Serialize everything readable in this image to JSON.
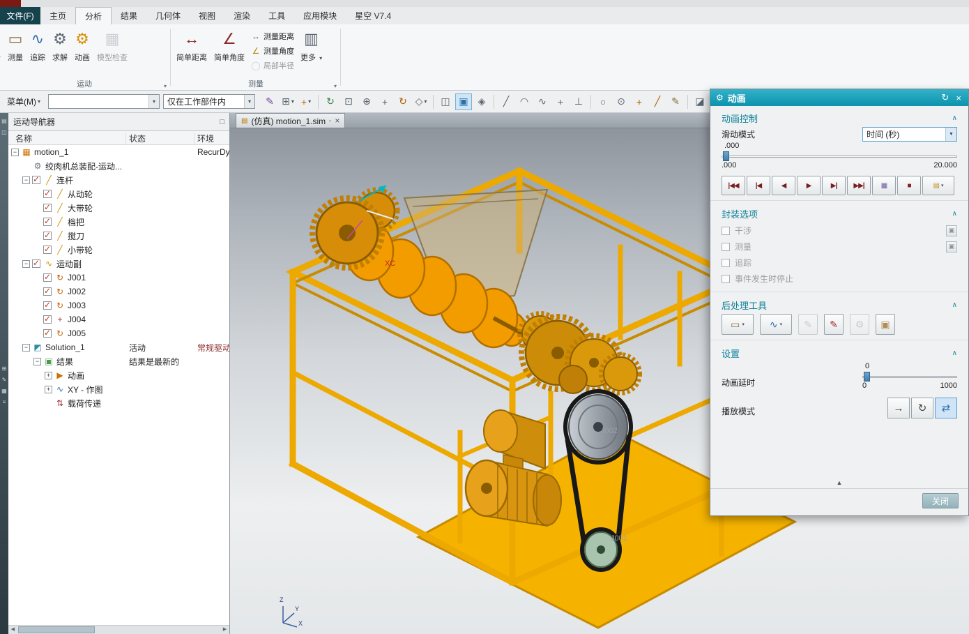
{
  "colors": {
    "accent_teal": "#1199b5",
    "section_teal": "#0f819b",
    "check_red": "#c3391c",
    "frame_gold": "#edaa00",
    "playback_maroon": "#7a1f1f",
    "active_blue_bg": "#cde6f7"
  },
  "glyphs": {
    "dropdown": "▾",
    "dropdown_lg": "▼",
    "chevron_up": "∧",
    "collapse_up": "▲",
    "close": "×",
    "doc_icon": "▤",
    "modified_icon": "▫",
    "scroll_left": "◀",
    "scroll_right": "▶",
    "window_icon": "□",
    "mini_button": "▣"
  },
  "titlebar": {
    "file_menu": "文件(F)",
    "tabs": [
      "主页",
      "分析",
      "结果",
      "几何体",
      "视图",
      "渲染",
      "工具",
      "应用模块",
      "星空 V7.4"
    ],
    "active_index": 1
  },
  "ribbon": {
    "motion_group": {
      "label": "运动",
      "buttons": [
        {
          "name": "interference",
          "label": "干涉",
          "glyph": "◫",
          "color": "#2a8aa0",
          "clipped": true
        },
        {
          "name": "measure",
          "label": "测量",
          "glyph": "▭",
          "color": "#8a6d3b"
        },
        {
          "name": "trace",
          "label": "追踪",
          "glyph": "∿",
          "color": "#3a6ea8"
        },
        {
          "name": "solve",
          "label": "求解",
          "glyph": "⚙",
          "color": "#5a6570"
        },
        {
          "name": "animation",
          "label": "动画",
          "glyph": "⚙",
          "color": "#d98f00"
        },
        {
          "name": "model-check",
          "label": "模型检查",
          "glyph": "▦",
          "color": "#9aa4ab",
          "disabled": true
        }
      ]
    },
    "measure_group": {
      "label": "测量",
      "large": [
        {
          "name": "simple-distance",
          "label": "简单距离",
          "glyph": "↔",
          "color": "#8a2a2a"
        },
        {
          "name": "simple-angle",
          "label": "简单角度",
          "glyph": "∠",
          "color": "#8a2a2a"
        }
      ],
      "small": [
        {
          "name": "measure-distance",
          "label": "测量距离",
          "glyph": "↔",
          "color": "#2a8aa0"
        },
        {
          "name": "measure-angle",
          "label": "测量角度",
          "glyph": "∠",
          "color": "#b8860b"
        },
        {
          "name": "local-radius",
          "label": "局部半径",
          "glyph": "◯",
          "color": "#9aa4ab",
          "disabled": true
        }
      ],
      "more": {
        "name": "more",
        "label": "更多",
        "glyph": "▥",
        "color": "#5a6570"
      }
    }
  },
  "toolbar": {
    "menu_label": "菜单(M)",
    "filter_value": "",
    "scope_value": "仅在工作部件内",
    "icons": [
      {
        "name": "style-edit",
        "glyph": "✎",
        "color": "#7a4a9a"
      },
      {
        "name": "snap-point",
        "glyph": "⊞",
        "color": "#5a6570",
        "dropdown": true
      },
      {
        "name": "wcs-dynamics",
        "glyph": "+",
        "color": "#c07000",
        "dropdown": true
      },
      {
        "sep": true
      },
      {
        "name": "refresh-view",
        "glyph": "↻",
        "color": "#3a7a4a"
      },
      {
        "name": "fit-view",
        "glyph": "⊡",
        "color": "#5a6570"
      },
      {
        "name": "zoom-view",
        "glyph": "⊕",
        "color": "#5a6570"
      },
      {
        "name": "pan-view",
        "glyph": "+",
        "color": "#5a6570"
      },
      {
        "name": "rotate-view",
        "glyph": "↻",
        "color": "#b06000"
      },
      {
        "name": "orient-view",
        "glyph": "◇",
        "color": "#5a6570",
        "dropdown": true
      },
      {
        "sep": true
      },
      {
        "name": "wireframe-display",
        "glyph": "◫",
        "color": "#5a6570"
      },
      {
        "name": "shaded-display",
        "glyph": "▣",
        "color": "#2f6fa8",
        "active": true
      },
      {
        "name": "view-effects",
        "glyph": "◈",
        "color": "#5a6570"
      },
      {
        "sep": true
      },
      {
        "name": "line-tool",
        "glyph": "╱",
        "color": "#5a6570"
      },
      {
        "name": "arc-tool",
        "glyph": "◠",
        "color": "#5a6570"
      },
      {
        "name": "spline-tool",
        "glyph": "∿",
        "color": "#5a6570"
      },
      {
        "name": "point-tool",
        "glyph": "+",
        "color": "#5a6570"
      },
      {
        "name": "profile-tool",
        "glyph": "⊥",
        "color": "#5a6570"
      },
      {
        "sep": true
      },
      {
        "name": "circle-tool",
        "glyph": "○",
        "color": "#5a6570"
      },
      {
        "name": "target-point",
        "glyph": "⊙",
        "color": "#5a6570"
      },
      {
        "name": "cross-tool",
        "glyph": "+",
        "color": "#b06000"
      },
      {
        "name": "diagonal-tool",
        "glyph": "╱",
        "color": "#b06000"
      },
      {
        "name": "annotate-tool",
        "glyph": "✎",
        "color": "#8a6d3b"
      },
      {
        "sep": true
      },
      {
        "name": "section-view",
        "glyph": "◪",
        "color": "#5a6570"
      },
      {
        "name": "layer-settings",
        "glyph": "▤",
        "color": "#5a6570"
      },
      {
        "sep": true
      },
      {
        "name": "render-window",
        "glyph": "▥",
        "color": "#5a6570"
      },
      {
        "name": "capture-image",
        "glyph": "◨",
        "color": "#5a6570"
      }
    ]
  },
  "resource_bar": {
    "icons": [
      {
        "name": "assembly-navigator-tab",
        "glyph": "▤"
      },
      {
        "name": "part-navigator-tab",
        "glyph": "◫"
      },
      {
        "name": "tools-palette-tab",
        "glyph": "⊞",
        "gap": true
      },
      {
        "name": "reuse-library-tab",
        "glyph": "✎"
      },
      {
        "name": "history-tab",
        "glyph": "▦"
      },
      {
        "name": "roles-tab",
        "glyph": "≡"
      }
    ]
  },
  "navigator": {
    "title": "运动导航器",
    "window_icon": "□",
    "columns": [
      "名称",
      "状态",
      "环境"
    ],
    "rows": [
      {
        "id": "motion-1",
        "name": "motion_1",
        "level": 0,
        "expander": "minus",
        "icon": "motion-simulation",
        "glyph": "▦",
        "color": "#d07000",
        "env": "RecurDy"
      },
      {
        "id": "assembly",
        "name": "绞肉机总装配-运动...",
        "level": 1,
        "icon": "assembly",
        "glyph": "⚙",
        "color": "#6a7480"
      },
      {
        "id": "links",
        "name": "连杆",
        "level": 1,
        "expander": "minus",
        "checked": true,
        "icon": "links-folder",
        "glyph": "╱",
        "color": "#d09000"
      },
      {
        "id": "link-follower",
        "name": "从动轮",
        "level": 2,
        "checked": true,
        "icon": "link",
        "glyph": "╱",
        "color": "#d09000"
      },
      {
        "id": "link-big-pulley",
        "name": "大带轮",
        "level": 2,
        "checked": true,
        "icon": "link",
        "glyph": "╱",
        "color": "#d09000"
      },
      {
        "id": "link-handle",
        "name": "档把",
        "level": 2,
        "checked": true,
        "icon": "link",
        "glyph": "╱",
        "color": "#d09000"
      },
      {
        "id": "link-blade",
        "name": "搅刀",
        "level": 2,
        "checked": true,
        "icon": "link",
        "glyph": "╱",
        "color": "#d09000"
      },
      {
        "id": "link-small-pulley",
        "name": "小带轮",
        "level": 2,
        "checked": true,
        "icon": "link",
        "glyph": "╱",
        "color": "#d09000"
      },
      {
        "id": "joints",
        "name": "运动副",
        "level": 1,
        "expander": "minus",
        "checked": true,
        "icon": "joints-folder",
        "glyph": "∿",
        "color": "#d09000"
      },
      {
        "id": "j001",
        "name": "J001",
        "level": 2,
        "checked": true,
        "icon": "revolute-joint",
        "glyph": "↻",
        "color": "#c06000"
      },
      {
        "id": "j002",
        "name": "J002",
        "level": 2,
        "checked": true,
        "icon": "revolute-joint",
        "glyph": "↻",
        "color": "#c06000"
      },
      {
        "id": "j003",
        "name": "J003",
        "level": 2,
        "checked": true,
        "icon": "revolute-joint",
        "glyph": "↻",
        "color": "#c06000"
      },
      {
        "id": "j004",
        "name": "J004",
        "level": 2,
        "checked": true,
        "icon": "fixed-joint",
        "glyph": "+",
        "color": "#c03030"
      },
      {
        "id": "j005",
        "name": "J005",
        "level": 2,
        "checked": true,
        "icon": "revolute-joint",
        "glyph": "↻",
        "color": "#c06000"
      },
      {
        "id": "solution-1",
        "name": "Solution_1",
        "level": 1,
        "expander": "minus",
        "icon": "solution",
        "glyph": "◩",
        "color": "#2a8aa0",
        "status": "活动",
        "env": "常规驱动",
        "env_color": "#8b2a2a"
      },
      {
        "id": "results",
        "name": "结果",
        "level": 2,
        "expander": "minus",
        "icon": "results",
        "glyph": "▣",
        "color": "#4a9a4a",
        "status": "结果是最新的"
      },
      {
        "id": "result-animation",
        "name": "动画",
        "level": 3,
        "expander": "plus",
        "icon": "animation-result",
        "glyph": "▶",
        "color": "#d07000"
      },
      {
        "id": "xy-graph",
        "name": "XY - 作图",
        "level": 3,
        "expander": "plus",
        "icon": "xy-graph",
        "glyph": "∿",
        "color": "#3a6ea8"
      },
      {
        "id": "load-transfer",
        "name": "载荷传递",
        "level": 3,
        "icon": "load-transfer",
        "glyph": "⇅",
        "color": "#a03030"
      }
    ]
  },
  "viewport": {
    "tab_label": "(仿真) motion_1.sim",
    "labels": [
      {
        "text": "XC"
      },
      {
        "text": "J002"
      },
      {
        "text": "J001"
      }
    ],
    "triad": {
      "x": "X",
      "y": "Y",
      "z": "Z"
    }
  },
  "anim": {
    "title": "动画",
    "header": {
      "gear": "⚙",
      "refresh": "↻",
      "close": "×"
    },
    "control": {
      "title": "动画控制",
      "slide_mode_label": "滑动模式",
      "slide_mode_value": "时间 (秒)",
      "current": ".000",
      "min": ".000",
      "max": "20.000",
      "fraction": 0,
      "playback": [
        {
          "name": "rewind-to-start",
          "glyph": "|◀◀"
        },
        {
          "name": "step-back",
          "glyph": "|◀"
        },
        {
          "name": "play-reverse",
          "glyph": "◀"
        },
        {
          "name": "play-forward",
          "glyph": "▶"
        },
        {
          "name": "step-forward",
          "glyph": "▶|"
        },
        {
          "name": "forward-to-end",
          "glyph": "▶▶|"
        },
        {
          "name": "export-movie",
          "glyph": "▦",
          "color": "#6a5aa0"
        },
        {
          "name": "stop",
          "glyph": "■",
          "color": "#8a2020"
        },
        {
          "name": "capture-animation",
          "glyph": "▤",
          "color": "#c09020",
          "dropdown": true
        }
      ]
    },
    "packaging": {
      "title": "封装选项",
      "options": [
        {
          "name": "interference",
          "label": "干涉",
          "side_button": true
        },
        {
          "name": "measure",
          "label": "测量",
          "side_button": true
        },
        {
          "name": "trace",
          "label": "追踪"
        },
        {
          "name": "stop-on-event",
          "label": "事件发生时停止"
        }
      ]
    },
    "post": {
      "title": "后处理工具",
      "buttons": [
        {
          "name": "measure-table",
          "glyph": "▭",
          "color": "#8a6d3b",
          "dropdown": true
        },
        {
          "name": "xy-graphing",
          "glyph": "∿",
          "color": "#3a6ea8",
          "dropdown": true
        },
        {
          "name": "edit-annotation",
          "glyph": "✎",
          "color": "#9aa4ab",
          "disabled": true
        },
        {
          "name": "trace-marker",
          "glyph": "✎",
          "color": "#a52a2a"
        },
        {
          "name": "mechanism-check",
          "glyph": "⚙",
          "color": "#9aa4ab",
          "disabled": true
        },
        {
          "name": "export-results",
          "glyph": "▣",
          "color": "#b08d57"
        }
      ]
    },
    "settings": {
      "title": "设置",
      "delay_label": "动画延时",
      "delay_value": "0",
      "delay_min": "0",
      "delay_max": "1000",
      "delay_fraction": 0,
      "play_mode_label": "播放模式",
      "play_modes": [
        {
          "name": "play-once",
          "glyph": "→"
        },
        {
          "name": "loop",
          "glyph": "↻"
        },
        {
          "name": "swing",
          "glyph": "⇄",
          "selected": true
        }
      ]
    },
    "close_label": "关闭"
  }
}
